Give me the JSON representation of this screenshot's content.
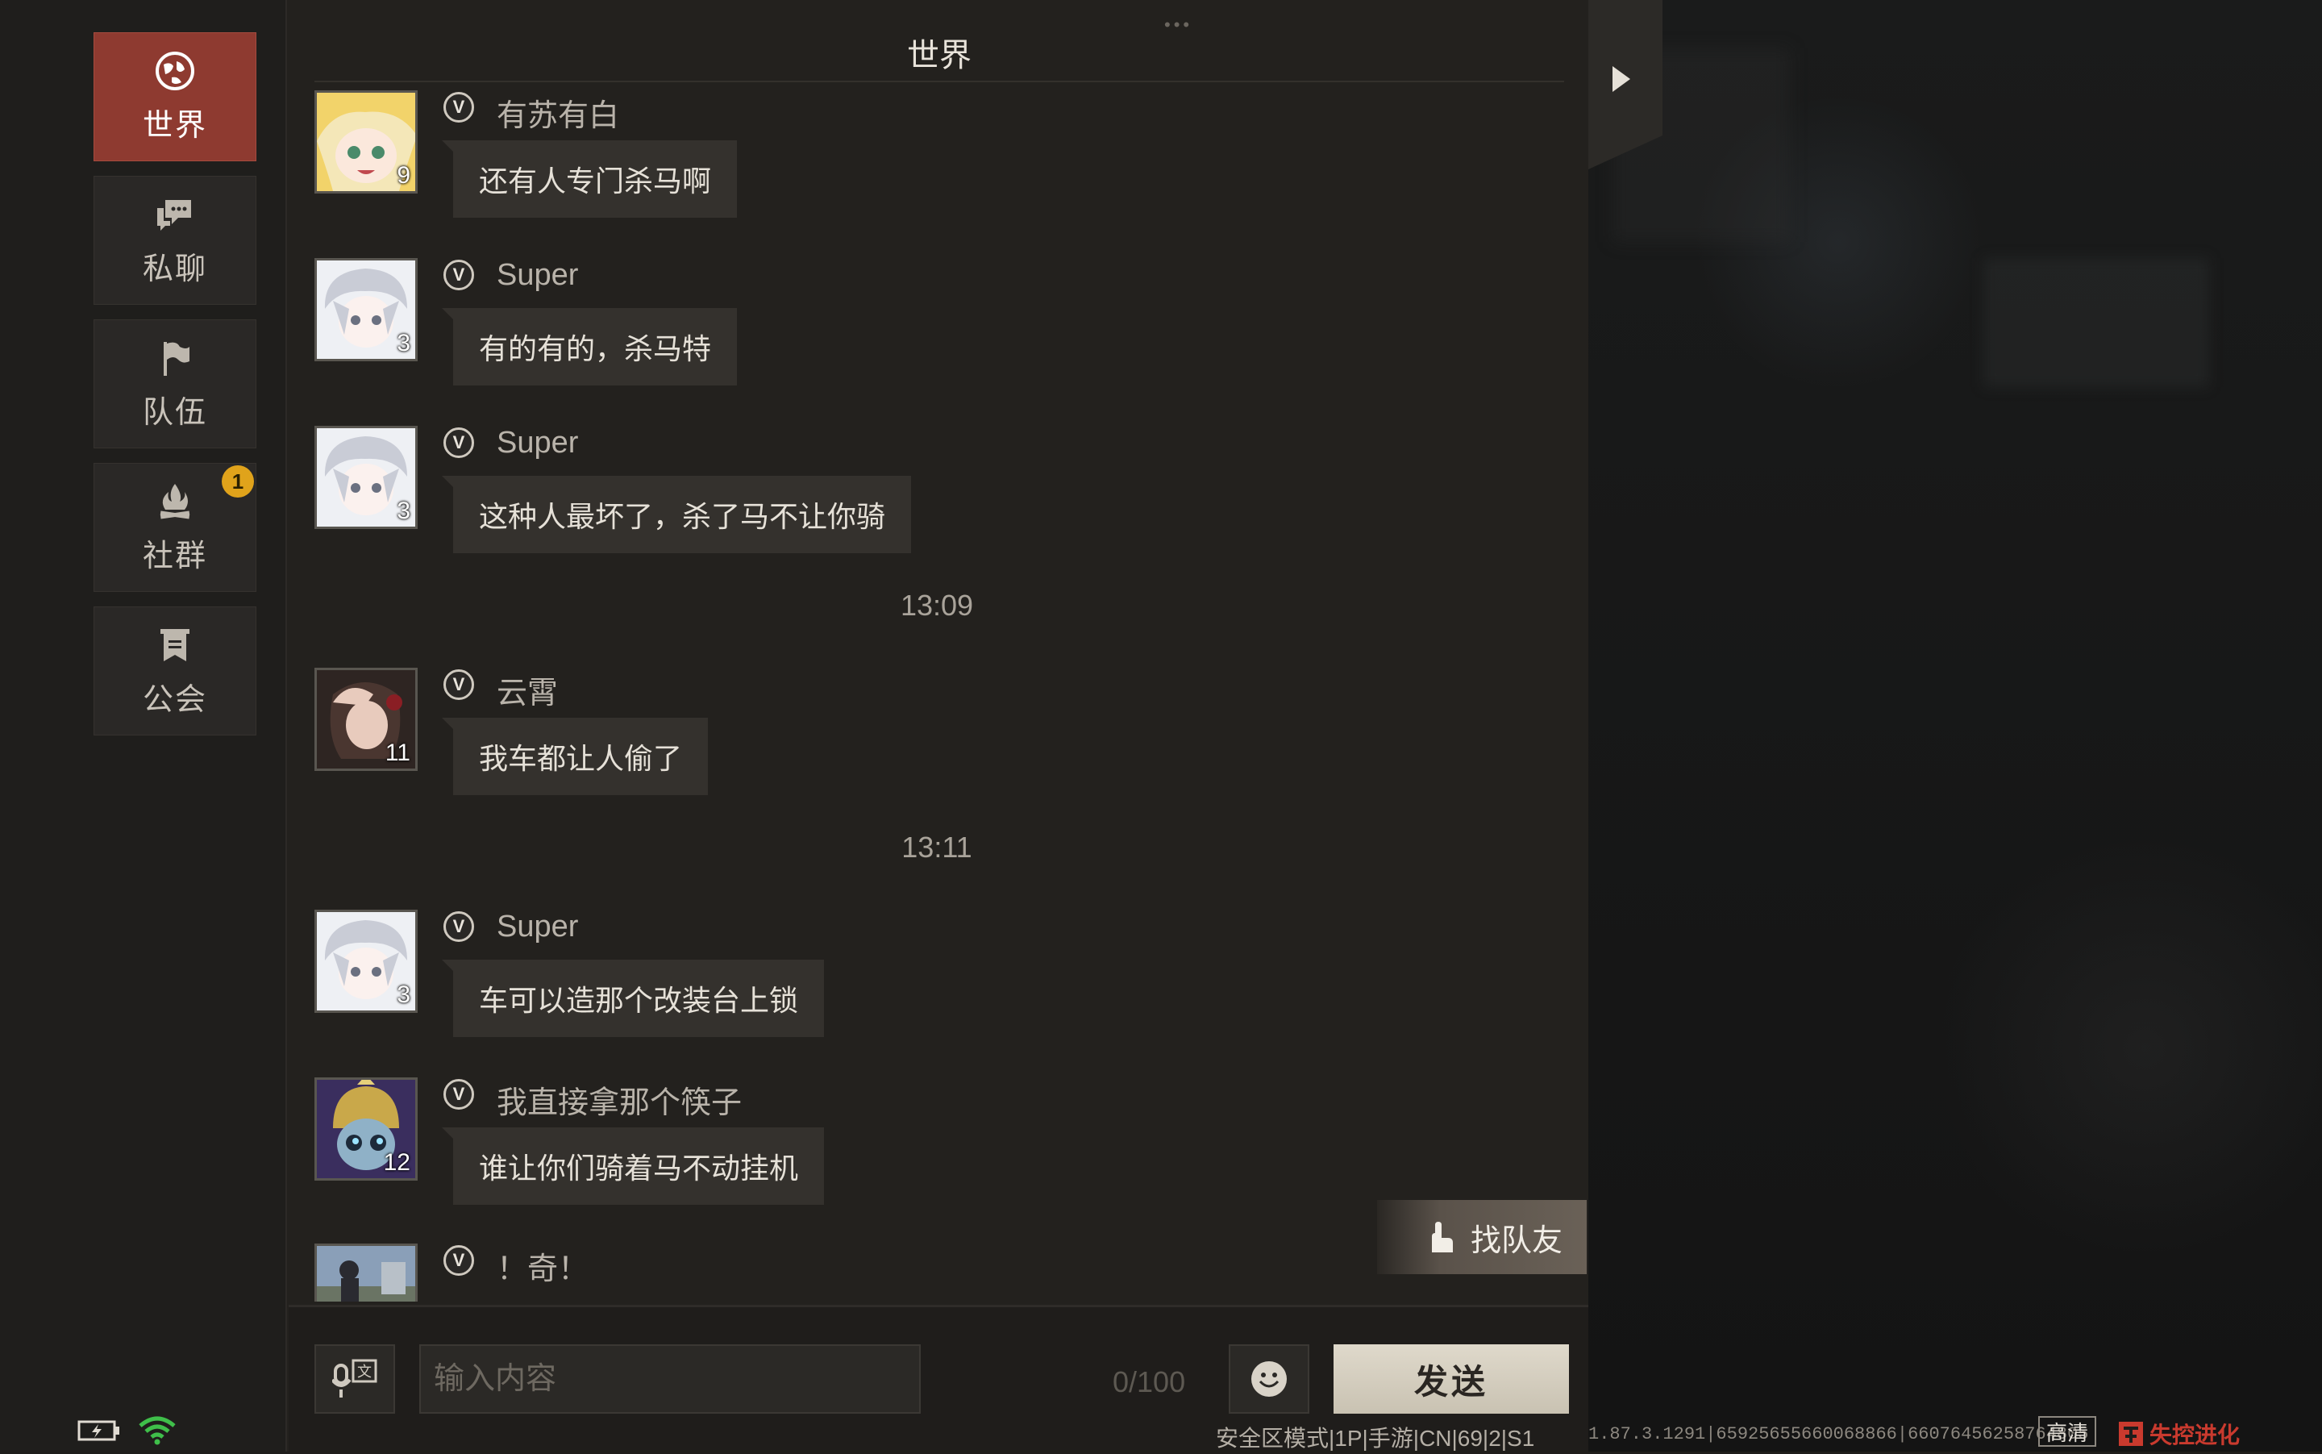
{
  "sidebar": {
    "items": [
      {
        "label": "世界",
        "icon": "globe-icon",
        "active": true
      },
      {
        "label": "私聊",
        "icon": "chat-bubbles-icon"
      },
      {
        "label": "队伍",
        "icon": "flag-icon"
      },
      {
        "label": "社群",
        "icon": "campfire-icon",
        "badge": "1"
      },
      {
        "label": "公会",
        "icon": "guild-banner-icon"
      }
    ]
  },
  "header": {
    "title": "世界"
  },
  "messages": [
    {
      "sender": "有苏有白",
      "level": "9",
      "text": "还有人专门杀马啊"
    },
    {
      "sender": "Super",
      "level": "3",
      "text": "有的有的，杀马特"
    },
    {
      "sender": "Super",
      "level": "3",
      "text": "这种人最坏了，杀了马不让你骑"
    },
    {
      "sender": "云霄",
      "level": "11",
      "text": "我车都让人偷了"
    },
    {
      "sender": "Super",
      "level": "3",
      "text": "车可以造那个改装台上锁"
    },
    {
      "sender": "我直接拿那个筷子",
      "level": "12",
      "text": "谁让你们骑着马不动挂机"
    },
    {
      "sender": "！奇！",
      "level": "",
      "text": ""
    }
  ],
  "timestamps": [
    "13:09",
    "13:11"
  ],
  "vip_label": "V",
  "find_team": {
    "label": "找队友"
  },
  "input": {
    "placeholder": "输入内容",
    "count": "0/100"
  },
  "send": {
    "label": "发送"
  },
  "footer": {
    "info": "安全区模式|1P|手游|CN|69|2|S1",
    "build": "1.87.3.1291|65925655660068866|66076456258764805",
    "quality": "高清",
    "logo": "失控进化"
  },
  "colors": {
    "accent": "#8e3a30",
    "badge": "#e0a31b",
    "send_button": "#d6cfbf"
  }
}
